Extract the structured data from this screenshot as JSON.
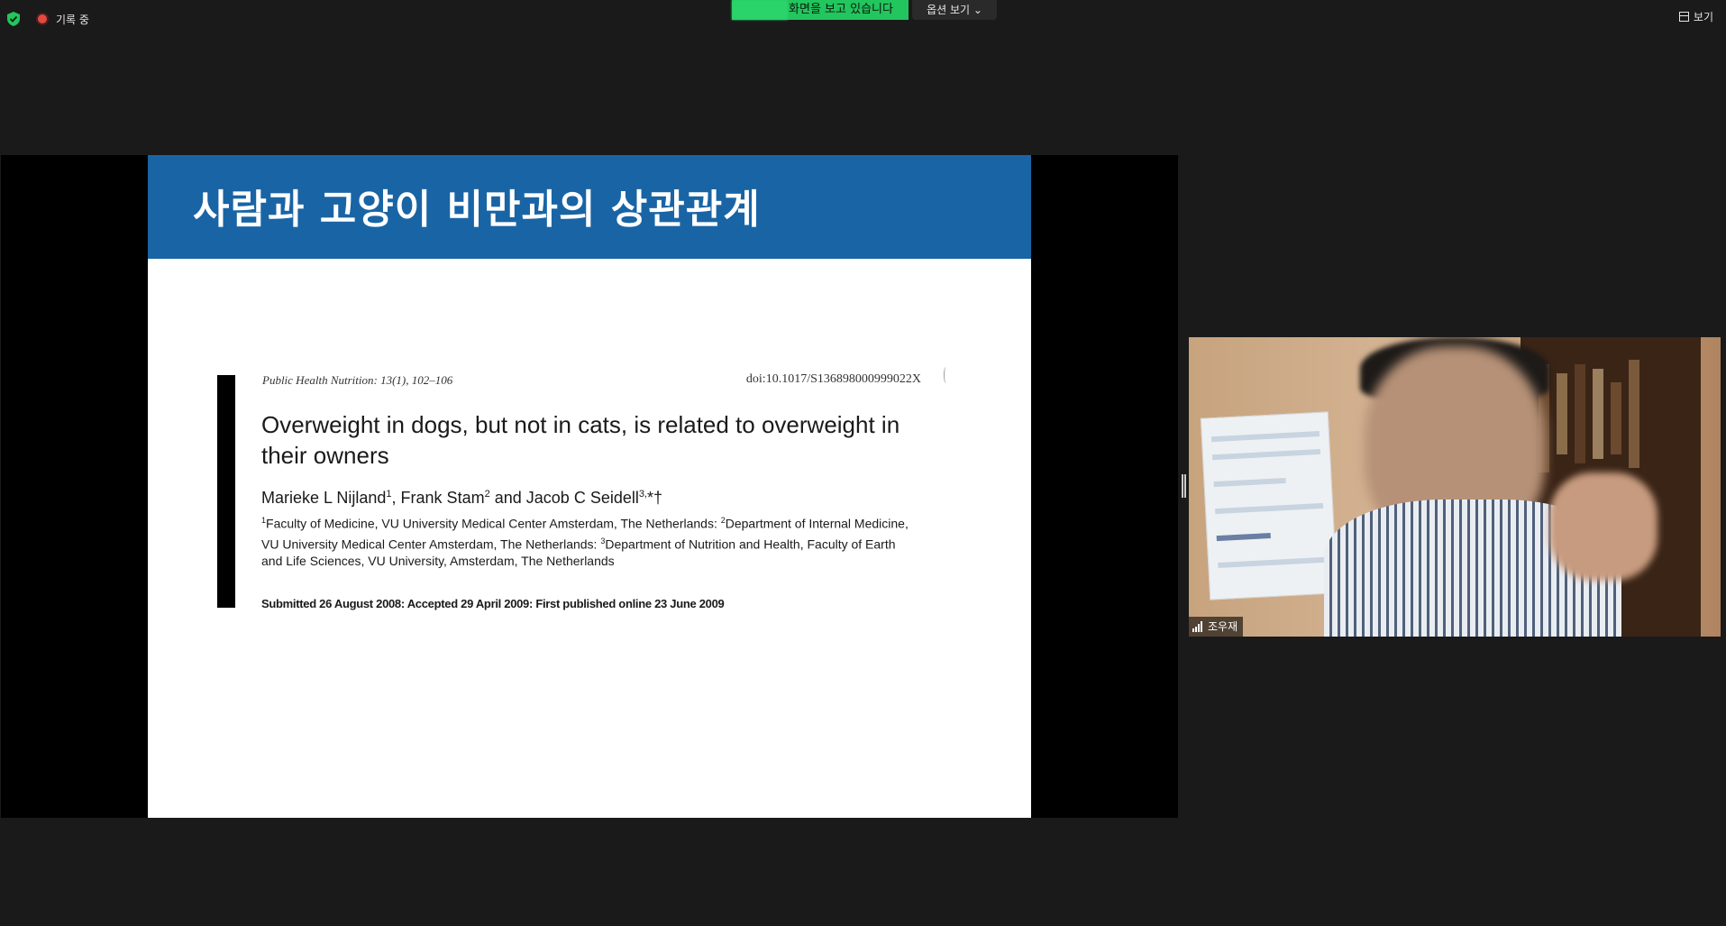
{
  "topbar": {
    "recording_label": "기록 중",
    "share_status": "화면을 보고 있습니다",
    "options_label": "옵션 보기",
    "view_label": "보기"
  },
  "slide": {
    "title": "사람과 고양이 비만과의 상관관계",
    "journal": "Public Health Nutrition: 13(1), 102–106",
    "doi": "doi:10.1017/S136898000999022X",
    "paper_title": "Overweight in dogs, but not in cats, is related to overweight in their owners",
    "author1": "Marieke L Nijland",
    "author1_sup": "1",
    "author2": "Frank Stam",
    "author2_sup": "2",
    "author_and": "and",
    "author3": "Jacob C Seidell",
    "author3_sup": "3,",
    "author3_mark": "*†",
    "affil_sup1": "1",
    "affil1": "Faculty of Medicine, VU University Medical Center Amsterdam, The Netherlands:",
    "affil_sup2": "2",
    "affil2": "Department of Internal Medicine, VU University Medical Center Amsterdam, The Netherlands:",
    "affil_sup3": "3",
    "affil3": "Department of Nutrition and Health, Faculty of Earth and Life Sciences, VU University, Amsterdam, The Netherlands",
    "submitted": "Submitted 26 August 2008: Accepted 29 April 2009: First published online 23 June 2009"
  },
  "participant": {
    "name": "조우재"
  },
  "colors": {
    "header_blue": "#1964a5",
    "share_green": "#22c55e",
    "background": "#1a1a1a"
  }
}
